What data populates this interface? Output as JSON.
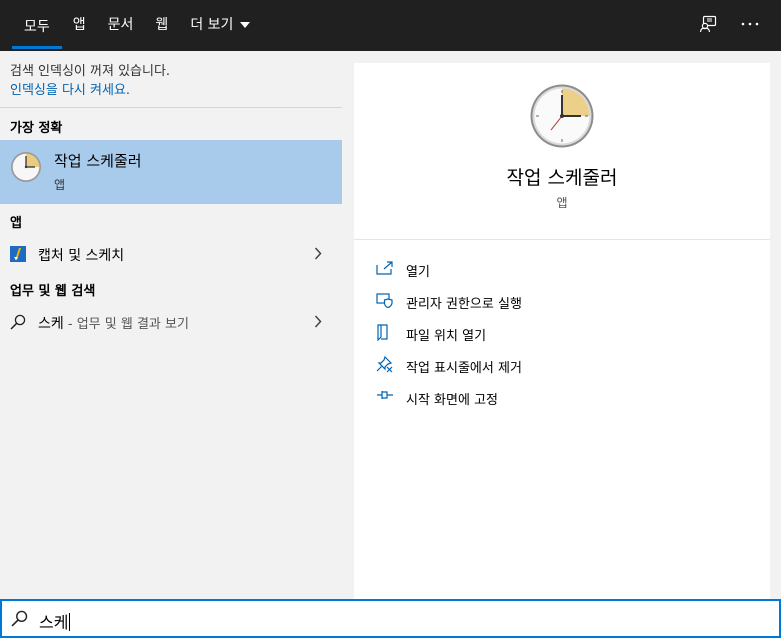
{
  "tabs": [
    {
      "label": "모두"
    },
    {
      "label": "앱"
    },
    {
      "label": "문서"
    },
    {
      "label": "웹"
    },
    {
      "label": "더 보기"
    }
  ],
  "top_icons": {
    "feedback": "feedback-icon",
    "more": "more-options-icon"
  },
  "notice": {
    "message": "검색 인덱싱이 꺼져 있습니다.",
    "link": "인덱싱을 다시 켜세요."
  },
  "best_match": {
    "section_title": "가장 정확",
    "name": "작업 스케줄러",
    "type": "앱"
  },
  "apps": {
    "section_title": "앱",
    "items": [
      {
        "label": "캡처 및 스케치",
        "icon": "snip-sketch-icon"
      }
    ]
  },
  "web": {
    "section_title": "업무 및 웹 검색",
    "query": "스케",
    "suffix": " - 업무 및 웹 결과 보기"
  },
  "detail": {
    "title": "작업 스케줄러",
    "type": "앱",
    "actions": [
      {
        "label": "열기",
        "icon": "open-icon"
      },
      {
        "label": "관리자 권한으로 실행",
        "icon": "shield-icon"
      },
      {
        "label": "파일 위치 열기",
        "icon": "file-location-icon"
      },
      {
        "label": "작업 표시줄에서 제거",
        "icon": "unpin-icon"
      },
      {
        "label": "시작 화면에 고정",
        "icon": "pin-icon"
      }
    ]
  },
  "search": {
    "value": "스케"
  },
  "colors": {
    "accent": "#0078d7",
    "selected": "#a8cbeb",
    "topbar": "#202020",
    "link": "#0063b1"
  }
}
